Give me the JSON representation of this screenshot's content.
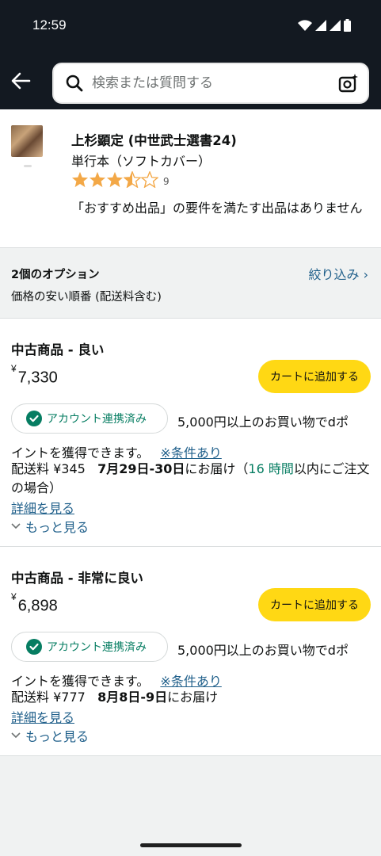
{
  "status_bar": {
    "time": "12:59"
  },
  "search": {
    "placeholder": "検索または質問する"
  },
  "product": {
    "title": "上杉顕定 (中世武士選書24)",
    "format": "単行本（ソフトカバー）",
    "rating": 3.5,
    "rating_count": "9",
    "note": "「おすすめ出品」の要件を満たす出品はありません"
  },
  "options": {
    "count_label": "2個のオプション",
    "sort_label": "価格の安い順番 (配送料含む)",
    "filter_label": "絞り込み ›"
  },
  "offers": [
    {
      "condition": "中古商品 - 良い",
      "currency": "¥",
      "price": "7,330",
      "cart_label": "カートに追加する",
      "linked_label": "アカウント連携済み",
      "points_line1": "5,000円以上のお買い物でdポ",
      "points_line2": "イントを獲得できます。",
      "conditions_link": "※条件あり",
      "shipping_prefix": "配送料 ¥345",
      "delivery_date": "7月29日-30日",
      "delivery_suffix": "にお届け（",
      "hours": "16 時間",
      "order_suffix": "以内にご注文の場合）",
      "detail_link": "詳細を見る",
      "more_link": "もっと見る"
    },
    {
      "condition": "中古商品 - 非常に良い",
      "currency": "¥",
      "price": "6,898",
      "cart_label": "カートに追加する",
      "linked_label": "アカウント連携済み",
      "points_line1": "5,000円以上のお買い物でdポ",
      "points_line2": "イントを獲得できます。",
      "conditions_link": "※条件あり",
      "shipping_prefix": "配送料 ¥777",
      "delivery_date": "8月8日-9日",
      "delivery_suffix": "にお届け",
      "detail_link": "詳細を見る",
      "more_link": "もっと見る"
    }
  ],
  "colors": {
    "header_bg": "#131921",
    "cart_button": "#ffd814",
    "link": "#1f5f8a",
    "linked_green": "#067d62",
    "star": "#f3a847"
  }
}
